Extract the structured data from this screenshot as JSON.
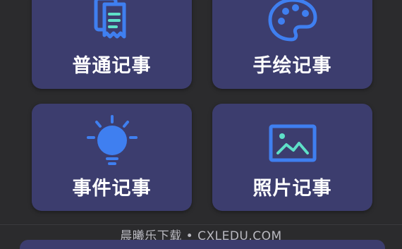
{
  "cards": {
    "normal_note": {
      "label": "普通记事",
      "icon": "document-icon"
    },
    "drawing_note": {
      "label": "手绘记事",
      "icon": "palette-icon"
    },
    "event_note": {
      "label": "事件记事",
      "icon": "lightbulb-icon"
    },
    "photo_note": {
      "label": "照片记事",
      "icon": "image-icon"
    }
  },
  "watermark": "晨曦乐下载 • CXLEDU.COM",
  "colors": {
    "background": "#2b2b2d",
    "card": "#3c3d6e",
    "icon_blue": "#3f7ff0",
    "icon_teal": "#5ee0c8"
  }
}
